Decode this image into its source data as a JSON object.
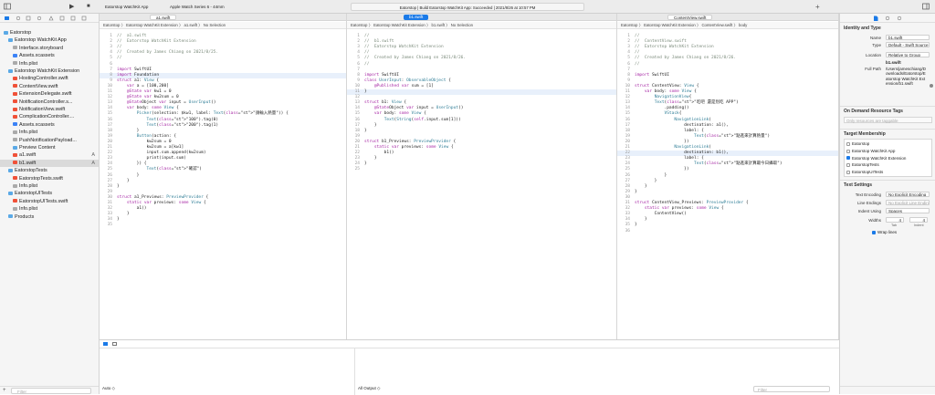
{
  "toolbar": {
    "scheme": "Eatorstop WatchKit App",
    "device": "Apple Watch Series 6 - 44mm",
    "status": "Eatorstop | Build Eatorstop WatchKit App: Succeeded | 2021/8/26 at 10:57 PM",
    "play": "▶",
    "stop": "■"
  },
  "navigator": {
    "filter": "Filter",
    "items": [
      {
        "label": "Eatorstop",
        "kind": "folder",
        "indent": 0,
        "badge": ""
      },
      {
        "label": "Eatorstop WatchKit App",
        "kind": "folder",
        "indent": 1,
        "badge": ""
      },
      {
        "label": "Interface.storyboard",
        "kind": "file",
        "indent": 2,
        "badge": ""
      },
      {
        "label": "Assets.xcassets",
        "kind": "asset",
        "indent": 2,
        "badge": ""
      },
      {
        "label": "Info.plist",
        "kind": "file",
        "indent": 2,
        "badge": ""
      },
      {
        "label": "Eatorstop WatchKit Extension",
        "kind": "folder",
        "indent": 1,
        "badge": ""
      },
      {
        "label": "HostingController.swift",
        "kind": "swift",
        "indent": 2,
        "badge": ""
      },
      {
        "label": "ContentView.swift",
        "kind": "swift",
        "indent": 2,
        "badge": ""
      },
      {
        "label": "ExtensionDelegate.swift",
        "kind": "swift",
        "indent": 2,
        "badge": ""
      },
      {
        "label": "NotificationController.s...",
        "kind": "swift",
        "indent": 2,
        "badge": ""
      },
      {
        "label": "NotificationView.swift",
        "kind": "swift",
        "indent": 2,
        "badge": ""
      },
      {
        "label": "ComplicationController....",
        "kind": "swift",
        "indent": 2,
        "badge": ""
      },
      {
        "label": "Assets.xcassets",
        "kind": "asset",
        "indent": 2,
        "badge": ""
      },
      {
        "label": "Info.plist",
        "kind": "file",
        "indent": 2,
        "badge": ""
      },
      {
        "label": "PushNotificationPayload...",
        "kind": "file",
        "indent": 2,
        "badge": ""
      },
      {
        "label": "Preview Content",
        "kind": "folder",
        "indent": 2,
        "badge": ""
      },
      {
        "label": "a1.swift",
        "kind": "swift",
        "indent": 2,
        "badge": "A"
      },
      {
        "label": "b1.swift",
        "kind": "swift",
        "indent": 2,
        "badge": "A"
      },
      {
        "label": "EatorstopTests",
        "kind": "folder",
        "indent": 1,
        "badge": ""
      },
      {
        "label": "EatorstopTests.swift",
        "kind": "swift",
        "indent": 2,
        "badge": ""
      },
      {
        "label": "Info.plist",
        "kind": "file",
        "indent": 2,
        "badge": ""
      },
      {
        "label": "EatorstopUITests",
        "kind": "folder",
        "indent": 1,
        "badge": ""
      },
      {
        "label": "EatorstopUITests.swift",
        "kind": "swift",
        "indent": 2,
        "badge": ""
      },
      {
        "label": "Info.plist",
        "kind": "file",
        "indent": 2,
        "badge": ""
      },
      {
        "label": "Products",
        "kind": "folder",
        "indent": 1,
        "badge": ""
      }
    ]
  },
  "editors": [
    {
      "tab": "a1.swift",
      "jump": "Eatorstop 〉 Eatorstop WatchKit Extension 〉 a1.swift 〉 No Selection",
      "lines": [
        "//  a1.swift",
        "//  Eatorstop WatchKit Extension",
        "//",
        "//  Created by James Chiang on 2021/8/25.",
        "//",
        "",
        "import SwiftUI",
        "import Foundation",
        "struct a1: View {",
        "    var a = [100,200]",
        "    @State var kw1 = 0",
        "    @State var kw2sum = 0",
        "    @StateObject var input = UserInput()",
        "    var body: some View {",
        "        Picker(selection: $kw1, label: Text(\"請輸入熱量\")) {",
        "            Text(\"100\").tag(0)",
        "            Text(\"200\").tag(1)",
        "        }",
        "        Button(action: {",
        "            kw2sum = 0",
        "            kw2sum = a[kw1]",
        "            input.sum.append(kw2sum)",
        "            print(input.sum)",
        "        }) {",
        "            Text(\"確認\")",
        "        }",
        "    }",
        "}",
        "",
        "struct a1_Previews: PreviewProvider {",
        "    static var previews: some View {",
        "        a1()",
        "    }",
        "}",
        ""
      ],
      "current": 8
    },
    {
      "tab": "b1.swift",
      "jump": "Eatorstop 〉 Eatorstop WatchKit Extension 〉 b1.swift 〉 No Selection",
      "lines": [
        "//",
        "//  b1.swift",
        "//  Eatorstop WatchKit Extension",
        "//",
        "//  Created by James Chiang on 2021/8/26.",
        "//",
        "",
        "import SwiftUI",
        "class UserInput: ObservableObject {",
        "    @Published var sum = [1]",
        "}",
        "",
        "struct b1: View {",
        "    @StateObject var input = UserInput()",
        "    var body: some View {",
        "        Text(String(self.input.sum[1]))",
        "    }",
        "}",
        "",
        "struct b1_Previews: PreviewProvider {",
        "    static var previews: some View {",
        "        b1()",
        "    }",
        "}",
        ""
      ],
      "current": 11
    },
    {
      "tab": "ContentView.swift",
      "jump": "Eatorstop 〉 Eatorstop WatchKit Extension 〉 ContentView.swift 〉 body",
      "lines": [
        "//",
        "//  ContentView.swift",
        "//  Eatorstop WatchKit Extension",
        "//",
        "//  Created by James Chiang on 2021/8/26.",
        "//",
        "",
        "import SwiftUI",
        "",
        "struct ContentView: View {",
        "    var body: some View {",
        "        NavigationView{",
        "        Text(\"吃吧 還是別吃 APP\")",
        "            .padding()",
        "            VStack{",
        "                NavigationLink(",
        "                    destination: a1(),",
        "                    label: {",
        "                        Text(\"點進來計算熱量\")",
        "                    })",
        "                NavigationLink(",
        "                    destination: b1(),",
        "                    label: {",
        "                        Text(\"點進來計算最今日攝取\")",
        "                    })",
        "            }",
        "        }",
        "    }",
        "}",
        "",
        "struct ContentView_Previews: PreviewProvider {",
        "    static var previews: some View {",
        "        ContentView()",
        "    }",
        "}",
        ""
      ],
      "current": 22
    }
  ],
  "debug": {
    "auto": "Auto ◇",
    "output": "All Output ◇",
    "filter": "Filter"
  },
  "inspector": {
    "section_identity": "Identity and Type",
    "name_label": "Name",
    "name_value": "b1.swift",
    "type_label": "Type",
    "type_value": "Default - Swift Source",
    "location_label": "Location",
    "location_value": "Relative to Group",
    "location_file": "b1.swift",
    "fullpath_label": "Full Path",
    "fullpath_value": "/Users/jameschiang/Downloads/Eatorstop/Eatorstop WatchKit Extension/b1.swift",
    "section_ondemand": "On Demand Resource Tags",
    "ondemand_placeholder": "Only resources are taggable",
    "section_target": "Target Membership",
    "targets": [
      {
        "label": "Eatorstop",
        "checked": false
      },
      {
        "label": "Eatorstop WatchKit App",
        "checked": false
      },
      {
        "label": "Eatorstop WatchKit Extension",
        "checked": true
      },
      {
        "label": "EatorstopTests",
        "checked": false
      },
      {
        "label": "EatorstopUITests",
        "checked": false
      }
    ],
    "section_text": "Text Settings",
    "encoding_label": "Text Encoding",
    "encoding_value": "No Explicit Encoding",
    "endings_label": "Line Endings",
    "endings_value": "No Explicit Line Endings",
    "indent_label": "Indent Using",
    "indent_value": "Spaces",
    "widths_label": "Widths",
    "tab_value": "4",
    "indent_num": "4",
    "tab_caption": "Tab",
    "indent_caption": "Indent",
    "wrap_label": "Wrap lines"
  }
}
